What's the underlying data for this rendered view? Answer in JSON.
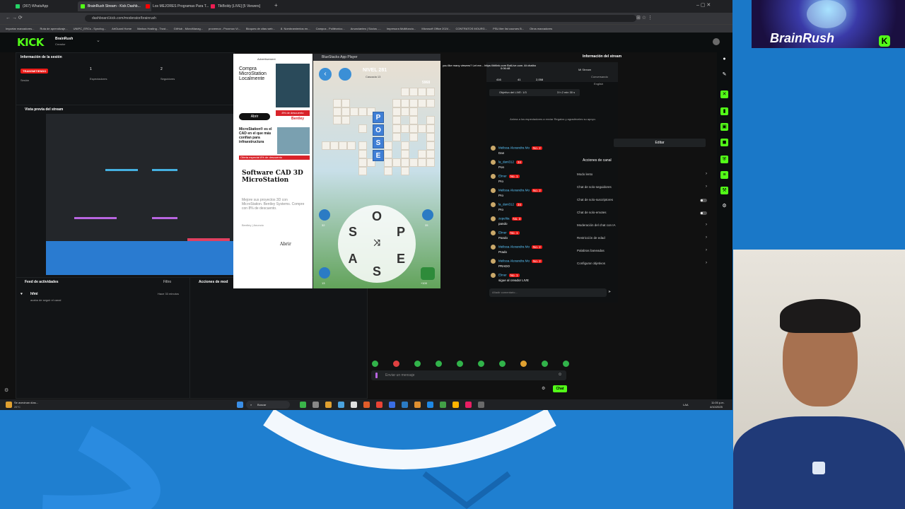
{
  "browser": {
    "tabs": [
      "(367) WhatsApp",
      "BrainRush Stream - Kick Dashb...",
      "Los MEJORES Programas Para T...",
      "TikBoldy [LIVE] [5 Viewers]"
    ],
    "url": "dashboard.kick.com/moderator/brainrush",
    "bookmarks": [
      "Importar marcadores...",
      "Ruta de aprendizaje...",
      "UNIPC_ERCs - Syncfog...",
      "ArtGuard Home",
      "Markus Hosting - Trust...",
      "GitHub - MicroManag...",
      "provemox - Proxmox Vi...",
      "Bloques de citas web...",
      "8. Nombramientos en...",
      "Campus - Politécnico...",
      "Anunciantes | Sócios -...",
      "Impresora Multifuncio...",
      "Microsoft Office 2024 -",
      "CONTRATOS MOURG...",
      "PSU liter list courses B...",
      "Otros marcadores"
    ]
  },
  "kick": {
    "logo": "KICK",
    "channel": "BrainRush",
    "role": "Creador"
  },
  "session": {
    "title": "Información de la sesión",
    "badge": "TRANSMITIENDO",
    "badge_sub": "Sesión",
    "viewers_count": "1",
    "viewers_label": "Espectadores",
    "followers_count": "2",
    "followers_label": "Seguidores"
  },
  "preview": {
    "title": "Vista previa del stream"
  },
  "feed": {
    "title": "Feed de actividades",
    "filter": "Filtro",
    "actions_title": "Acciones de mod",
    "item_name": "hfmi",
    "item_text": "acaba de seguir el canal",
    "item_time": "Hace 33 minutos"
  },
  "ad": {
    "label": "Advertisement",
    "headline": "Compra MicroStation Localmente",
    "open_button": "Abrir",
    "discount": "8% de descuento",
    "brand": "Bentley",
    "body2": "MicroStation® es el CAD en el que más confían para infraestructura",
    "offer": "Oferta especial 8% de descuento",
    "headline3": "Software CAD 3D MicroStation",
    "body3": "Mejore sus proyectos 3D con MicroStation. Bentley Systems. Compre con 8% de descuento.",
    "source": "Bentley | Anuncio",
    "open_button2": "Abrir"
  },
  "game": {
    "window_title": "BlueStacks App Player",
    "level": "NIVEL 281",
    "subtitle": "Cascada 13",
    "coins": "5968",
    "letters_found": [
      "P",
      "O",
      "S",
      "E"
    ],
    "wheel_letters": [
      "O",
      "S",
      "P",
      "E",
      "A",
      "S"
    ],
    "hint_left": "32",
    "hint_right": "35",
    "bottom_left": "13",
    "bottom_right": "+100"
  },
  "chat": {
    "ticker": "you like many viewers? Let me... https://bitlink.com BotLive.com. At chatbo",
    "stats": [
      "0:06:48",
      "416",
      "41",
      "2,058"
    ],
    "goal_label": "Objetivo del LIVE: 1/3",
    "goal_time": "3 h 2 min 30 s",
    "invite": "Anima a los espectadores a enviar Regalos y agradéceles su apoyo.",
    "messages": [
      {
        "name": "Melissa Alexandra Mo",
        "level": "No. 2",
        "text": "Dan"
      },
      {
        "name": "la_dani312",
        "level": "34",
        "text": "Pon"
      },
      {
        "name": "Elmer",
        "level": "No. 1",
        "text": "Pro"
      },
      {
        "name": "Melissa Alexandra Mo",
        "level": "No. 2",
        "text": "Pro"
      },
      {
        "name": "la_dani312",
        "level": "34",
        "text": "Pro"
      },
      {
        "name": "zepelita",
        "level": "No. 3",
        "text": "pando"
      },
      {
        "name": "Elmer",
        "level": "No. 1",
        "text": "Pando"
      },
      {
        "name": "Melissa Alexandra Mo",
        "level": "No. 2",
        "text": "Prado"
      },
      {
        "name": "Melissa Alexandra Mo",
        "level": "No. 2",
        "text": "PRADO"
      },
      {
        "name": "Elmer",
        "level": "No. 1",
        "text": "sigue al creador LIVE"
      }
    ],
    "comment_placeholder": "Añadir comentario..."
  },
  "stream_info": {
    "title": "Información del stream",
    "stream_title": "Mi Stream",
    "category": "Conversando",
    "language": "English",
    "edit": "Editar",
    "channel_actions": "Acciones de canal",
    "rows": [
      "Modo lento",
      "Chat de solo-seguidores",
      "Chat de solo-suscriptores",
      "Chat de solo-emotes",
      "Moderación del chat con IA",
      "Restricción de edad",
      "Palabras baneadas",
      "Configurar objetivos"
    ]
  },
  "message_box": {
    "placeholder": "Enviar un mensaje",
    "send": "Chat"
  },
  "taskbar": {
    "search": "Buscar",
    "weather": "Se avecinan días...",
    "temp": "26°C",
    "lang": "LAA",
    "time": "11:05 p.m.",
    "date": "4/10/2025"
  },
  "overlay": {
    "logo_text": "BrainRush"
  }
}
